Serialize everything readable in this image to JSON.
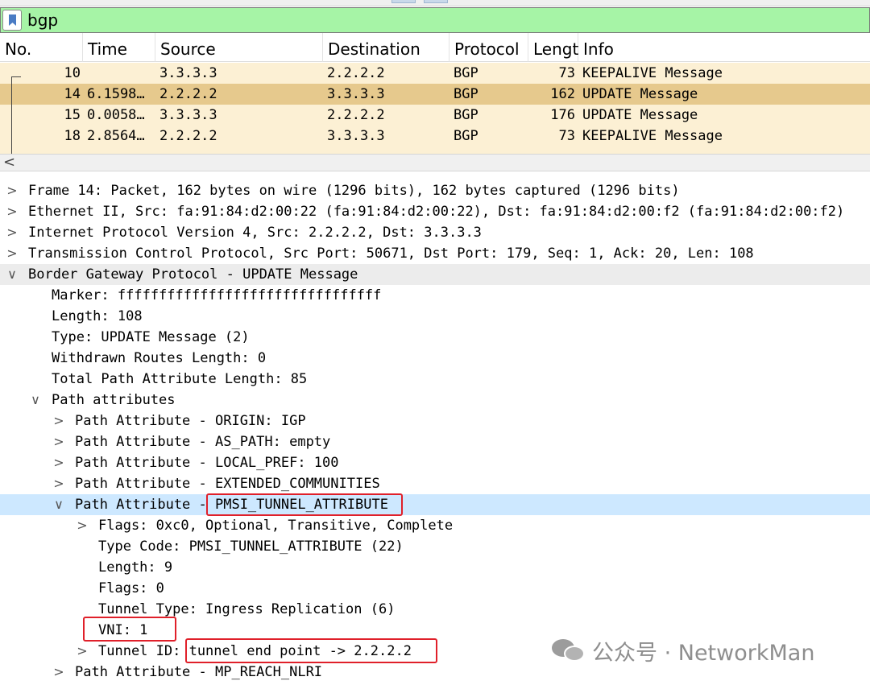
{
  "filter": {
    "value": "bgp",
    "bookmark_icon": "bookmark-icon"
  },
  "packet_list": {
    "columns": [
      "No.",
      "Time",
      "Source",
      "Destination",
      "Protocol",
      "Lengt",
      "Info"
    ],
    "rows": [
      {
        "no": "10",
        "time": "",
        "source": "3.3.3.3",
        "destination": "2.2.2.2",
        "protocol": "BGP",
        "length": "73",
        "info": "KEEPALIVE Message"
      },
      {
        "no": "14",
        "time": "6.1598…",
        "source": "2.2.2.2",
        "destination": "3.3.3.3",
        "protocol": "BGP",
        "length": "162",
        "info": "UPDATE Message"
      },
      {
        "no": "15",
        "time": "0.0058…",
        "source": "3.3.3.3",
        "destination": "2.2.2.2",
        "protocol": "BGP",
        "length": "176",
        "info": "UPDATE Message"
      },
      {
        "no": "18",
        "time": "2.8564…",
        "source": "2.2.2.2",
        "destination": "3.3.3.3",
        "protocol": "BGP",
        "length": "73",
        "info": "KEEPALIVE Message"
      }
    ]
  },
  "scrollbar": {
    "left_arrow": "<"
  },
  "tree": [
    {
      "text": "Frame 14: Packet, 162 bytes on wire (1296 bits), 162 bytes captured (1296 bits)",
      "chevron": ">"
    },
    {
      "text": "Ethernet II, Src: fa:91:84:d2:00:22 (fa:91:84:d2:00:22), Dst: fa:91:84:d2:00:f2 (fa:91:84:d2:00:f2)",
      "chevron": ">"
    },
    {
      "text": "Internet Protocol Version 4, Src: 2.2.2.2, Dst: 3.3.3.3",
      "chevron": ">"
    },
    {
      "text": "Transmission Control Protocol, Src Port: 50671, Dst Port: 179, Seq: 1, Ack: 20, Len: 108",
      "chevron": ">"
    },
    {
      "text": "Border Gateway Protocol - UPDATE Message",
      "chevron": "∨"
    },
    {
      "text": "Marker: ffffffffffffffffffffffffffffffff",
      "chevron": ""
    },
    {
      "text": "Length: 108",
      "chevron": ""
    },
    {
      "text": "Type: UPDATE Message (2)",
      "chevron": ""
    },
    {
      "text": "Withdrawn Routes Length: 0",
      "chevron": ""
    },
    {
      "text": "Total Path Attribute Length: 85",
      "chevron": ""
    },
    {
      "text": "Path attributes",
      "chevron": "∨"
    },
    {
      "text": "Path Attribute - ORIGIN: IGP",
      "chevron": ">"
    },
    {
      "text": "Path Attribute - AS_PATH: empty",
      "chevron": ">"
    },
    {
      "text": "Path Attribute - LOCAL_PREF: 100",
      "chevron": ">"
    },
    {
      "text": "Path Attribute - EXTENDED_COMMUNITIES",
      "chevron": ">"
    },
    {
      "text": "Path Attribute - PMSI_TUNNEL_ATTRIBUTE",
      "chevron": "∨"
    },
    {
      "text": "Flags: 0xc0, Optional, Transitive, Complete",
      "chevron": ">"
    },
    {
      "text": "Type Code: PMSI_TUNNEL_ATTRIBUTE (22)",
      "chevron": ""
    },
    {
      "text": "Length: 9",
      "chevron": ""
    },
    {
      "text": "Flags: 0",
      "chevron": ""
    },
    {
      "text": "Tunnel Type: Ingress Replication (6)",
      "chevron": ""
    },
    {
      "text": "VNI: 1",
      "chevron": ""
    },
    {
      "text": "Tunnel ID: tunnel end point -> 2.2.2.2",
      "chevron": ">"
    },
    {
      "text": "Path Attribute - MP_REACH_NLRI",
      "chevron": ">"
    }
  ],
  "watermark": {
    "text": "公众号 · NetworkMan",
    "icon": "wechat-icon"
  },
  "colors": {
    "filter_ok": "#a6f4a6",
    "row_bg": "#fcf0d4",
    "row_selected": "#e6c98d",
    "tree_selected": "#cde8ff",
    "annotation": "#e0202a"
  }
}
